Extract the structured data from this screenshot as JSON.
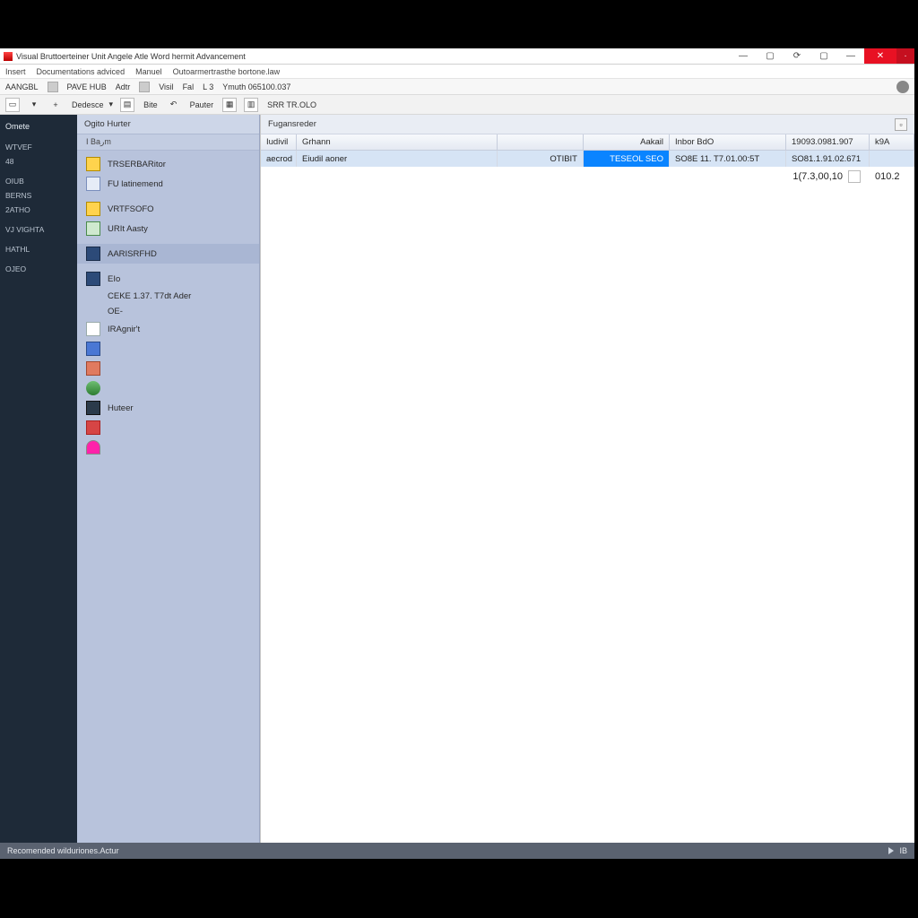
{
  "window_title": "Visual Bruttоertеiner Unit Angele Atle Word hermit Advancement",
  "menubar": [
    "Insert",
    "Documentations adviced",
    "Manuel",
    "Outoarmertrasthe bortone.law"
  ],
  "cmdrow": {
    "left": "AANGBL",
    "items": [
      "PAVE HUB",
      "Adtr",
      "Visil",
      "Fal",
      "L   3"
    ],
    "right": "Ymuth 065100.037"
  },
  "toolbar": {
    "design": "Dedesce",
    "bite": "Bite",
    "poster": "Pauter",
    "sr": "SRR TR.OLO"
  },
  "rail": {
    "head": "Omete",
    "items": [
      "WTVEF",
      "48",
      "",
      "OIUB",
      "BERNS",
      "2ATHO",
      "",
      "VJ VIGHTA",
      "",
      "HATHL",
      "",
      "OJEO"
    ]
  },
  "tree": {
    "header": "Ogito  Hurter",
    "sub": "I Baرm",
    "nodes": [
      {
        "label": "TRSERBARitor",
        "icon": "y"
      },
      {
        "label": "FU latinemend",
        "icon": "b"
      },
      {
        "label": "",
        "icon": ""
      },
      {
        "label": "VRTFSOFO",
        "icon": "y"
      },
      {
        "label": "URIt Aasty",
        "icon": "g"
      },
      {
        "label": "",
        "icon": ""
      },
      {
        "label": "AARISRFHD",
        "icon": "db",
        "sel": true
      },
      {
        "label": "",
        "icon": ""
      },
      {
        "label": "EIo",
        "icon": "db"
      },
      {
        "label": "CEKE 1.37. T7dt Ader",
        "icon": ""
      },
      {
        "label": "OE-",
        "icon": ""
      },
      {
        "label": "IRAgnir't",
        "icon": "w"
      },
      {
        "label": "",
        "icon": "bl"
      },
      {
        "label": "",
        "icon": "red"
      },
      {
        "label": "",
        "icon": "gr"
      },
      {
        "label": "Huteer",
        "icon": "dk"
      },
      {
        "label": "",
        "icon": "rd"
      },
      {
        "label": "",
        "icon": "pk"
      }
    ]
  },
  "main": {
    "header": "Fugansreder",
    "columns": [
      "Iudivil",
      "Grhann",
      "",
      "Aakail",
      "Inbor BdO",
      "19093.0981.907",
      "",
      "k9A"
    ],
    "row": {
      "a": "aecrod",
      "b": "Eiudil aoner",
      "c": "OTIBIT",
      "d": "TESEOL SEO",
      "e": "SO8E   11. T7.01.00:5T",
      "f": "SO81.1.91.02.671",
      "g": ""
    },
    "summary": {
      "amount": "1(7.3,00,10",
      "v2": "010.2"
    }
  },
  "status": {
    "left": "Recomended wilduriones.Actur",
    "right": "IB"
  }
}
